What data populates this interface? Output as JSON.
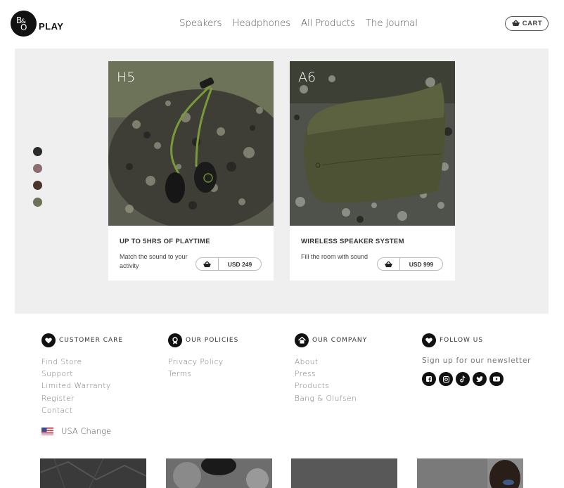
{
  "header": {
    "logo": {
      "mark": [
        "B",
        "&",
        "O"
      ],
      "text": "PLAY"
    },
    "nav": [
      "Speakers",
      "Headphones",
      "All Products",
      "The Journal"
    ],
    "cart_label": "CART"
  },
  "hero": {
    "color_swatches": [
      "#2b2b2b",
      "#8d6e6f",
      "#4a352c",
      "#6e7258"
    ],
    "products": [
      {
        "code": "H5",
        "title": "UP TO 5HRS OF PLAYTIME",
        "description": "Match the sound to your activity",
        "price": "USD 249"
      },
      {
        "code": "A6",
        "title": "WIRELESS SPEAKER SYSTEM",
        "description": "Fill the room with sound",
        "price": "USD 999"
      }
    ]
  },
  "footer": {
    "customer_care": {
      "heading": "CUSTOMER CARE",
      "links": [
        "Find Store",
        "Support",
        "Limited Warranty",
        "Register",
        "Contact"
      ]
    },
    "our_policies": {
      "heading": "OUR POLICIES",
      "links": [
        "Privacy Policy",
        "Terms"
      ]
    },
    "our_company": {
      "heading": "OUR COMPANY",
      "links": [
        "About",
        "Press",
        "Products",
        "Bang & Olufsen"
      ]
    },
    "follow_us": {
      "heading": "FOLLOW US",
      "newsletter": "Sign up for our newsletter",
      "socials": [
        "facebook-icon",
        "instagram-icon",
        "tiktok-icon",
        "twitter-icon",
        "youtube-icon"
      ]
    },
    "country": {
      "label": "USA Change"
    }
  }
}
